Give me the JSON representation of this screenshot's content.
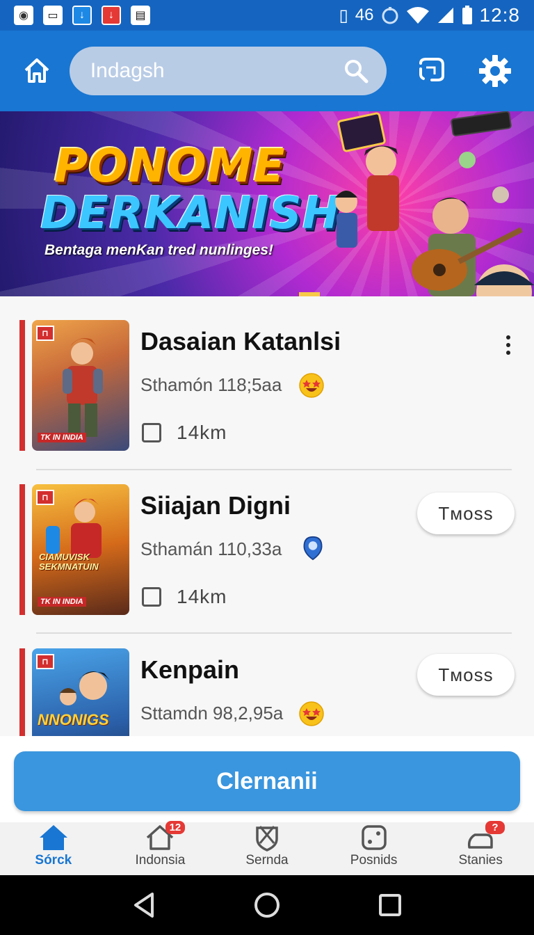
{
  "status_bar": {
    "notification_icons": [
      "photo-icon",
      "screen-icon",
      "download-icon",
      "download-red-icon",
      "app-icon"
    ],
    "signal_text": "46",
    "time": "12:8"
  },
  "app_bar": {
    "search_placeholder": "Indagsh"
  },
  "banner": {
    "title_line1": "PONOME",
    "title_line2": "DERKANISH",
    "tagline": "Bentaga menKan tred nunlinges!"
  },
  "items": [
    {
      "title": "Dasaian Katanlsi",
      "subtitle": "Sthamón 118;5aa",
      "distance": "14km",
      "action": "more",
      "cover_label": "TK IN INDIA",
      "emoji": "star-eyes"
    },
    {
      "title": "Siiajan Digni",
      "subtitle": "Sthamán 110,33a",
      "distance": "14km",
      "action_label": "Tмoss",
      "cover_label": "TK IN INDIA",
      "cover_title": "CIAMUVISK SEKMNATUIN",
      "emoji": "blue-pin"
    },
    {
      "title": "Kenpain",
      "subtitle": "Sttamdn  98,2,95a",
      "action_label": "Tмoss",
      "cover_title": "NNONIGS",
      "emoji": "star-eyes"
    }
  ],
  "cta": {
    "label": "Clernanii"
  },
  "bottom_nav": [
    {
      "label": "Sórck",
      "icon": "home-icon",
      "active": true
    },
    {
      "label": "Indonsia",
      "icon": "house-outline-icon",
      "badge": "12"
    },
    {
      "label": "Sernda",
      "icon": "shield-icon"
    },
    {
      "label": "Posnids",
      "icon": "dice-icon"
    },
    {
      "label": "Stanies",
      "icon": "chat-icon",
      "badge": "?"
    }
  ],
  "colors": {
    "primary": "#1976d2",
    "accent_red": "#d32f2f",
    "cta": "#3a96de"
  }
}
